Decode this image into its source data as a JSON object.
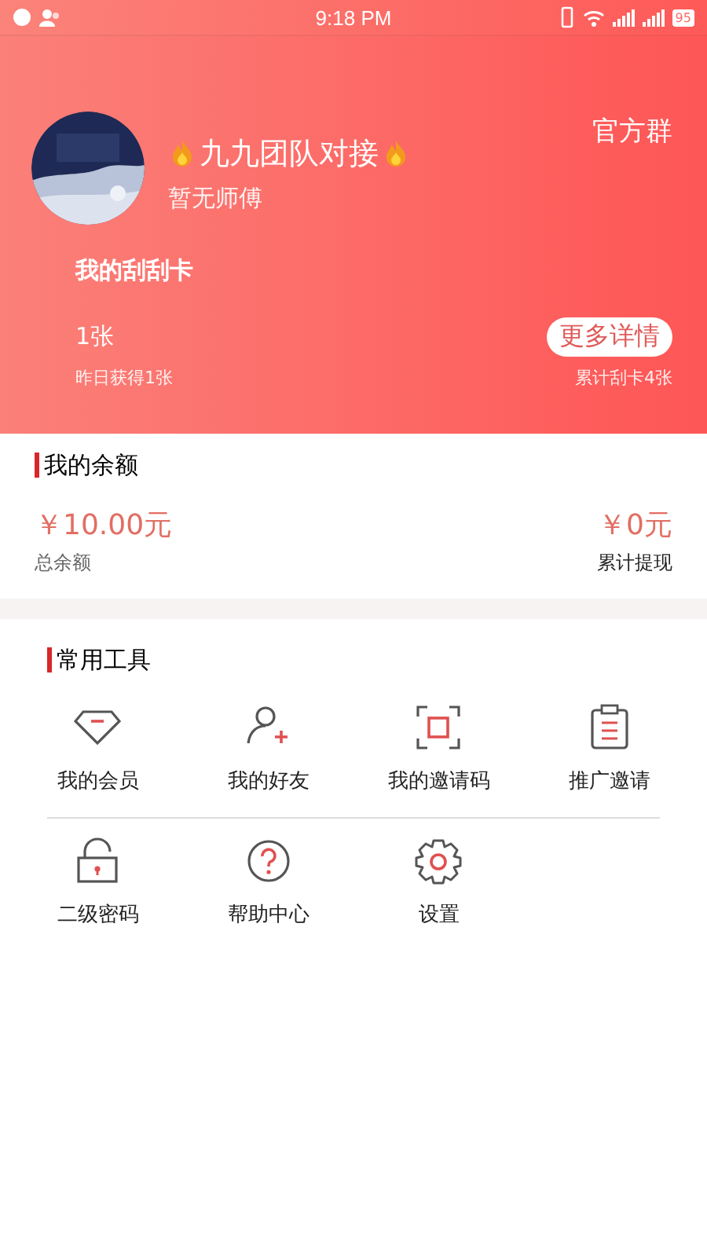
{
  "status_bar": {
    "time": "9:18 PM",
    "battery": "95"
  },
  "profile": {
    "name": "九九团队对接",
    "subtitle": "暂无师傅",
    "group_link": "官方群"
  },
  "scratch_card": {
    "title": "我的刮刮卡",
    "count": "1张",
    "yesterday": "昨日获得1张",
    "more_button": "更多详情",
    "total": "累计刮卡4张"
  },
  "balance": {
    "title": "我的余额",
    "total_amount": "￥10.00元",
    "total_label": "总余额",
    "withdrawn_amount": "￥0元",
    "withdrawn_label": "累计提现"
  },
  "tools": {
    "title": "常用工具",
    "rows": [
      [
        {
          "kind": "diamond",
          "label": "我的会员"
        },
        {
          "kind": "person-add",
          "label": "我的好友"
        },
        {
          "kind": "frame",
          "label": "我的邀请码"
        },
        {
          "kind": "clipboard",
          "label": "推广邀请"
        }
      ],
      [
        {
          "kind": "lock",
          "label": "二级密码"
        },
        {
          "kind": "help",
          "label": "帮助中心"
        },
        {
          "kind": "gear",
          "label": "设置"
        }
      ]
    ]
  }
}
